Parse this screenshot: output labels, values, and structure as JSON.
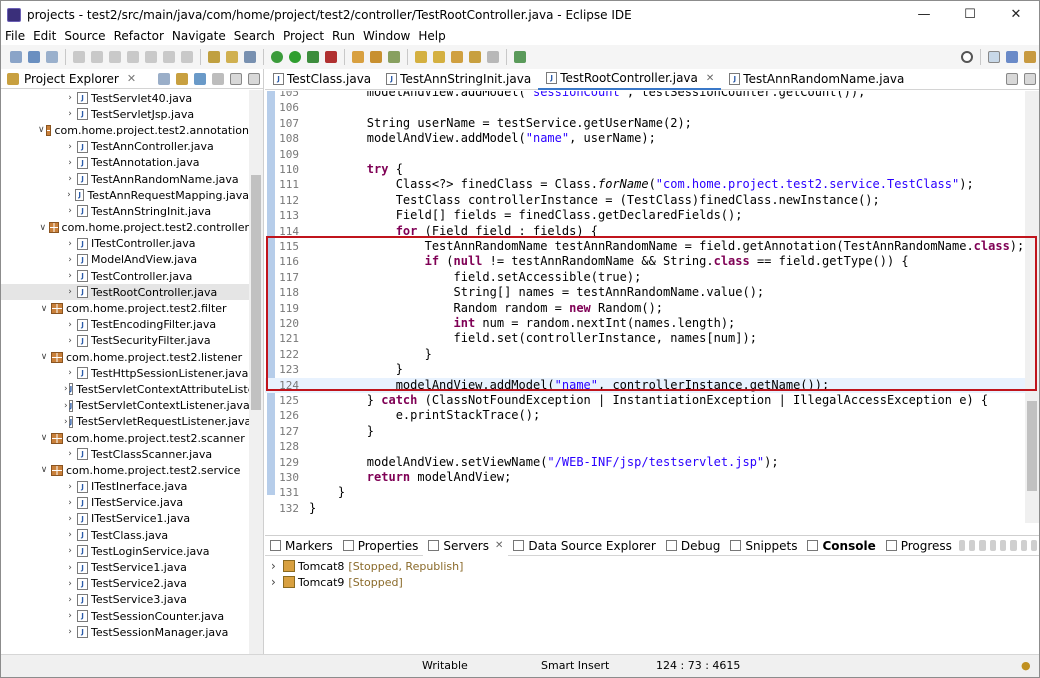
{
  "window": {
    "title": "projects - test2/src/main/java/com/home/project/test2/controller/TestRootController.java - Eclipse IDE"
  },
  "menu": [
    "File",
    "Edit",
    "Source",
    "Refactor",
    "Navigate",
    "Search",
    "Project",
    "Run",
    "Window",
    "Help"
  ],
  "explorer": {
    "title": "Project Explorer",
    "items": [
      {
        "label": "TestServlet40.java",
        "kind": "file",
        "indent": 5
      },
      {
        "label": "TestServletJsp.java",
        "kind": "file",
        "indent": 5
      },
      {
        "label": "com.home.project.test2.annotation",
        "kind": "pkg",
        "indent": 3
      },
      {
        "label": "TestAnnController.java",
        "kind": "file",
        "indent": 5
      },
      {
        "label": "TestAnnotation.java",
        "kind": "file",
        "indent": 5
      },
      {
        "label": "TestAnnRandomName.java",
        "kind": "file",
        "indent": 5
      },
      {
        "label": "TestAnnRequestMapping.java",
        "kind": "file",
        "indent": 5
      },
      {
        "label": "TestAnnStringInit.java",
        "kind": "file",
        "indent": 5
      },
      {
        "label": "com.home.project.test2.controller",
        "kind": "pkg",
        "indent": 3
      },
      {
        "label": "ITestController.java",
        "kind": "file",
        "indent": 5
      },
      {
        "label": "ModelAndView.java",
        "kind": "file",
        "indent": 5
      },
      {
        "label": "TestController.java",
        "kind": "file",
        "indent": 5
      },
      {
        "label": "TestRootController.java",
        "kind": "file",
        "indent": 5,
        "selected": true
      },
      {
        "label": "com.home.project.test2.filter",
        "kind": "pkg",
        "indent": 3
      },
      {
        "label": "TestEncodingFilter.java",
        "kind": "file",
        "indent": 5
      },
      {
        "label": "TestSecurityFilter.java",
        "kind": "file",
        "indent": 5
      },
      {
        "label": "com.home.project.test2.listener",
        "kind": "pkg",
        "indent": 3
      },
      {
        "label": "TestHttpSessionListener.java",
        "kind": "file",
        "indent": 5
      },
      {
        "label": "TestServletContextAttributeListe",
        "kind": "file",
        "indent": 5
      },
      {
        "label": "TestServletContextListener.java",
        "kind": "file",
        "indent": 5
      },
      {
        "label": "TestServletRequestListener.java",
        "kind": "file",
        "indent": 5
      },
      {
        "label": "com.home.project.test2.scanner",
        "kind": "pkg",
        "indent": 3
      },
      {
        "label": "TestClassScanner.java",
        "kind": "file",
        "indent": 5
      },
      {
        "label": "com.home.project.test2.service",
        "kind": "pkg",
        "indent": 3
      },
      {
        "label": "ITestInerface.java",
        "kind": "file",
        "indent": 5
      },
      {
        "label": "ITestService.java",
        "kind": "file",
        "indent": 5
      },
      {
        "label": "ITestService1.java",
        "kind": "file",
        "indent": 5
      },
      {
        "label": "TestClass.java",
        "kind": "file",
        "indent": 5
      },
      {
        "label": "TestLoginService.java",
        "kind": "file",
        "indent": 5
      },
      {
        "label": "TestService1.java",
        "kind": "file",
        "indent": 5
      },
      {
        "label": "TestService2.java",
        "kind": "file",
        "indent": 5
      },
      {
        "label": "TestService3.java",
        "kind": "file",
        "indent": 5
      },
      {
        "label": "TestSessionCounter.java",
        "kind": "file",
        "indent": 5
      },
      {
        "label": "TestSessionManager.java",
        "kind": "file",
        "indent": 5
      }
    ]
  },
  "editor_tabs": [
    {
      "label": "TestClass.java"
    },
    {
      "label": "TestAnnStringInit.java"
    },
    {
      "label": "TestRootController.java",
      "active": true
    },
    {
      "label": "TestAnnRandomName.java"
    }
  ],
  "code": [
    {
      "n": "105",
      "t": "        modelAndView.addModel(\"sessionCount\", testSessionCounter.getCount());"
    },
    {
      "n": "106",
      "t": ""
    },
    {
      "n": "107",
      "t": "        String userName = testService.getUserName(2);"
    },
    {
      "n": "108",
      "t": "        modelAndView.addModel(\"name\", userName);"
    },
    {
      "n": "109",
      "t": ""
    },
    {
      "n": "110",
      "t": "        try {"
    },
    {
      "n": "111",
      "t": "            Class<?> finedClass = Class.forName(\"com.home.project.test2.service.TestClass\");"
    },
    {
      "n": "112",
      "t": "            TestClass controllerInstance = (TestClass)finedClass.newInstance();"
    },
    {
      "n": "113",
      "t": "            Field[] fields = finedClass.getDeclaredFields();"
    },
    {
      "n": "114",
      "t": "            for (Field field : fields) {"
    },
    {
      "n": "115",
      "t": "                TestAnnRandomName testAnnRandomName = field.getAnnotation(TestAnnRandomName.class);"
    },
    {
      "n": "116",
      "t": "                if (null != testAnnRandomName && String.class == field.getType()) {"
    },
    {
      "n": "117",
      "t": "                    field.setAccessible(true);"
    },
    {
      "n": "118",
      "t": "                    String[] names = testAnnRandomName.value();"
    },
    {
      "n": "119",
      "t": "                    Random random = new Random();"
    },
    {
      "n": "120",
      "t": "                    int num = random.nextInt(names.length);"
    },
    {
      "n": "121",
      "t": "                    field.set(controllerInstance, names[num]);"
    },
    {
      "n": "122",
      "t": "                }"
    },
    {
      "n": "123",
      "t": "            }"
    },
    {
      "n": "124",
      "t": "            modelAndView.addModel(\"name\", controllerInstance.getName());",
      "current": true
    },
    {
      "n": "125",
      "t": "        } catch (ClassNotFoundException | InstantiationException | IllegalAccessException e) {"
    },
    {
      "n": "126",
      "t": "            e.printStackTrace();"
    },
    {
      "n": "127",
      "t": "        }"
    },
    {
      "n": "128",
      "t": ""
    },
    {
      "n": "129",
      "t": "        modelAndView.setViewName(\"/WEB-INF/jsp/testservlet.jsp\");"
    },
    {
      "n": "130",
      "t": "        return modelAndView;"
    },
    {
      "n": "131",
      "t": "    }"
    },
    {
      "n": "132",
      "t": "}"
    }
  ],
  "bottom_tabs": [
    {
      "label": "Markers"
    },
    {
      "label": "Properties"
    },
    {
      "label": "Servers",
      "active": true
    },
    {
      "label": "Data Source Explorer"
    },
    {
      "label": "Debug"
    },
    {
      "label": "Snippets"
    },
    {
      "label": "Console",
      "bold": true
    },
    {
      "label": "Progress"
    }
  ],
  "servers": [
    {
      "name": "Tomcat8",
      "status": "[Stopped, Republish]"
    },
    {
      "name": "Tomcat9",
      "status": "[Stopped]"
    }
  ],
  "status": {
    "writable": "Writable",
    "insert_mode": "Smart Insert",
    "position": "124 : 73 : 4615"
  }
}
